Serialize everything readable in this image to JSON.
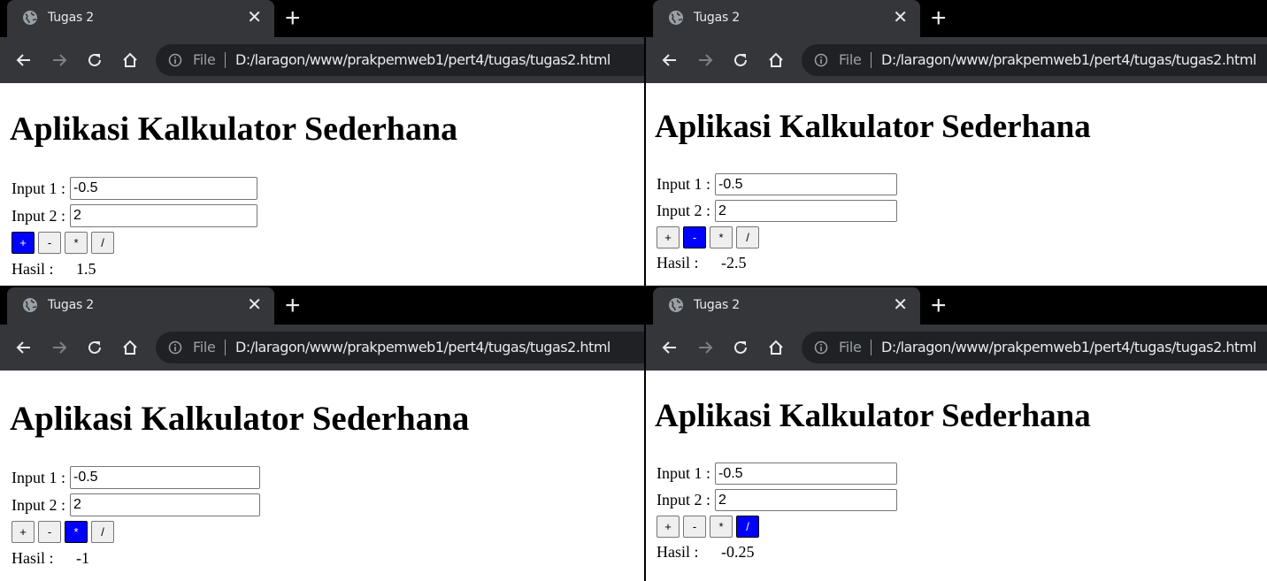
{
  "windows": [
    {
      "tab_title": "Tugas 2",
      "file_chip": "File",
      "url": "D:/laragon/www/prakpemweb1/pert4/tugas/tugas2.html",
      "page_title": "Aplikasi Kalkulator Sederhana",
      "input1_label": "Input 1 :",
      "input1_value": "-0.5",
      "input2_label": "Input 2 :",
      "input2_value": "2",
      "ops": [
        "+",
        "-",
        "*",
        "/"
      ],
      "active_op": "+",
      "hasil_label": "Hasil :",
      "hasil_value": "1.5"
    },
    {
      "tab_title": "Tugas 2",
      "file_chip": "File",
      "url": "D:/laragon/www/prakpemweb1/pert4/tugas/tugas2.html",
      "page_title": "Aplikasi Kalkulator Sederhana",
      "input1_label": "Input 1 :",
      "input1_value": "-0.5",
      "input2_label": "Input 2 :",
      "input2_value": "2",
      "ops": [
        "+",
        "-",
        "*",
        "/"
      ],
      "active_op": "-",
      "hasil_label": "Hasil :",
      "hasil_value": "-2.5"
    },
    {
      "tab_title": "Tugas 2",
      "file_chip": "File",
      "url": "D:/laragon/www/prakpemweb1/pert4/tugas/tugas2.html",
      "page_title": "Aplikasi Kalkulator Sederhana",
      "input1_label": "Input 1 :",
      "input1_value": "-0.5",
      "input2_label": "Input 2 :",
      "input2_value": "2",
      "ops": [
        "+",
        "-",
        "*",
        "/"
      ],
      "active_op": "*",
      "hasil_label": "Hasil :",
      "hasil_value": "-1"
    },
    {
      "tab_title": "Tugas 2",
      "file_chip": "File",
      "url": "D:/laragon/www/prakpemweb1/pert4/tugas/tugas2.html",
      "page_title": "Aplikasi Kalkulator Sederhana",
      "input1_label": "Input 1 :",
      "input1_value": "-0.5",
      "input2_label": "Input 2 :",
      "input2_value": "2",
      "ops": [
        "+",
        "-",
        "*",
        "/"
      ],
      "active_op": "/",
      "hasil_label": "Hasil :",
      "hasil_value": "-0.25"
    }
  ],
  "icons": {
    "tab": "globe-icon",
    "close": "close-icon",
    "new_tab": "plus-icon",
    "back": "arrow-back-icon",
    "forward": "arrow-forward-icon",
    "reload": "reload-icon",
    "home": "home-icon",
    "info": "info-icon"
  },
  "colors": {
    "chrome_dark": "#35363a",
    "omnibox": "#202124",
    "active_button": "#0000ff"
  }
}
